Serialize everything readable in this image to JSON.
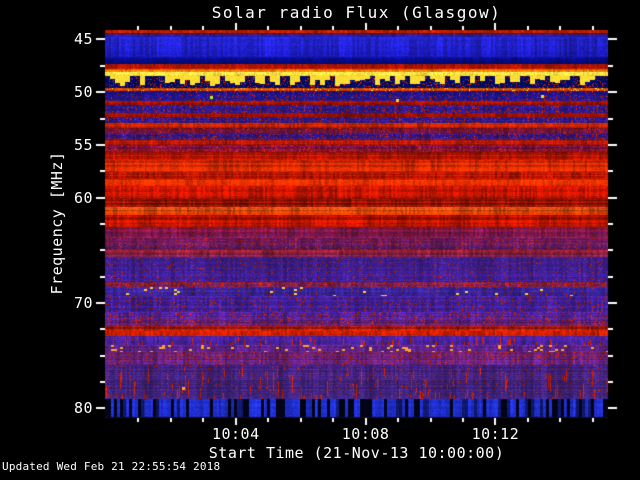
{
  "title": "Solar radio Flux (Glasgow)",
  "footer": {
    "updated": "Updated Wed Feb 21 22:55:54 2018"
  },
  "colors": {
    "background": "#000000",
    "foreground": "#ffffff"
  },
  "axes": {
    "x": {
      "label": "Start Time (21-Nov-13 10:00:00)",
      "date": "21-Nov-13",
      "start_time": "10:00:00",
      "range_seconds": [
        0,
        930
      ],
      "minor_step_seconds": 60,
      "ticks": [
        {
          "label": "10:04",
          "seconds": 240
        },
        {
          "label": "10:08",
          "seconds": 480
        },
        {
          "label": "10:12",
          "seconds": 720
        }
      ]
    },
    "y": {
      "label": "Frequency [MHz]",
      "unit": "MHz",
      "tick_labels": [
        45,
        50,
        55,
        60,
        70,
        80
      ],
      "minor_step_mhz": 2.5,
      "range_mhz": [
        44.2,
        81.0
      ]
    }
  },
  "chart_data": {
    "type": "heatmap",
    "title": "Solar radio Flux (Glasgow)",
    "xlabel": "Start Time (21-Nov-13 10:00:00)",
    "ylabel": "Frequency [MHz]",
    "x_tick_labels": [
      "10:04",
      "10:08",
      "10:12"
    ],
    "y_tick_labels": [
      45,
      50,
      55,
      60,
      70,
      80
    ],
    "x_range": [
      "10:00:00",
      "10:15:30"
    ],
    "y_range_mhz": [
      44.2,
      81.0
    ],
    "legend_position": "none",
    "grid": false,
    "palette": "dark blue/purple = low flux, red = high flux, yellow/white = strongest (RFI lines)",
    "hot_pixels": [
      {
        "t_frac": 0.211,
        "f_mhz": 50.55,
        "c": "#bbee22"
      },
      {
        "t_frac": 0.581,
        "f_mhz": 50.84,
        "c": "#ffcc33"
      },
      {
        "t_frac": 0.868,
        "f_mhz": 50.5,
        "c": "#ccee33"
      },
      {
        "t_frac": 0.155,
        "f_mhz": 78.15,
        "c": "#ffaa33"
      }
    ],
    "bands": [
      {
        "f0": 44.2,
        "f1": 44.48,
        "c0": "#c22000",
        "c1": "#c22000",
        "rv": 0.3,
        "cv": 0.5,
        "label": "red top edge"
      },
      {
        "f0": 44.48,
        "f1": 44.86,
        "c0": "#551133",
        "c1": "#2020bb",
        "rv": 0.2,
        "cv": 0.4
      },
      {
        "f0": 44.86,
        "f1": 46.76,
        "c0": "#2424d2",
        "c1": "#1a1abe",
        "rv": 0.15,
        "cv": 0.5,
        "label": "quiet blue band"
      },
      {
        "f0": 46.76,
        "f1": 47.42,
        "c0": "#0e0ea0",
        "c1": "#000a74",
        "rv": 0.2,
        "cv": 0.35
      },
      {
        "f0": 47.42,
        "f1": 47.9,
        "c0": "#a81500",
        "c1": "#c41a00",
        "rv": 0.35,
        "cv": 0.45
      },
      {
        "f0": 47.9,
        "f1": 48.18,
        "c0": "#e65f00",
        "c1": "#ff9900",
        "rv": 0.2,
        "cv": 0.3
      },
      {
        "f0": 48.18,
        "f1": 48.56,
        "c0": "#ffee55",
        "c1": "#ffdd33",
        "rv": 0.12,
        "cv": 0.22,
        "label": "strong RFI line 48.3 MHz"
      },
      {
        "f0": 48.56,
        "f1": 49.7,
        "c0": "#000a60",
        "c1": "#000a60",
        "rv": 0.2,
        "cv": 0.3,
        "fx": "comb",
        "teeth": "#ffdd33",
        "sp": "#cc2200",
        "sp_p": 0.15,
        "label": "keyed RFI comb"
      },
      {
        "f0": 49.7,
        "f1": 49.99,
        "c0": "#e05500",
        "c1": "#cc3300",
        "rv": 0.3,
        "cv": 0.45,
        "sp": "#ffee44",
        "sp_p": 0.08
      },
      {
        "f0": 49.99,
        "f1": 50.93,
        "c0": "#1a1080",
        "c1": "#241688",
        "rv": 0.25,
        "cv": 0.35,
        "sp": "#bb2200",
        "sp_p": 0.1
      },
      {
        "f0": 50.93,
        "f1": 51.31,
        "c0": "#a81300",
        "c1": "#a81300",
        "rv": 0.4,
        "cv": 0.5
      },
      {
        "f0": 51.31,
        "f1": 52.07,
        "c0": "#281788",
        "c1": "#281788",
        "rv": 0.3,
        "cv": 0.4,
        "sp": "#bb2200",
        "sp_p": 0.14
      },
      {
        "f0": 52.07,
        "f1": 52.45,
        "c0": "#a81300",
        "c1": "#b01500",
        "rv": 0.4,
        "cv": 0.5
      },
      {
        "f0": 52.45,
        "f1": 53.02,
        "c0": "#2a1888",
        "c1": "#2a1888",
        "rv": 0.3,
        "cv": 0.4,
        "sp": "#bb2200",
        "sp_p": 0.14
      },
      {
        "f0": 53.02,
        "f1": 53.5,
        "c0": "#d42800",
        "c1": "#c81e00",
        "rv": 0.35,
        "cv": 0.5
      },
      {
        "f0": 53.5,
        "f1": 54.06,
        "c0": "#701030",
        "c1": "#581448",
        "rv": 0.3,
        "cv": 0.45,
        "sp": "#bb2200",
        "sp_p": 0.12
      },
      {
        "f0": 54.06,
        "f1": 54.63,
        "c0": "#2a1585",
        "c1": "#3a1878",
        "rv": 0.3,
        "cv": 0.4,
        "sp": "#bb2200",
        "sp_p": 0.13
      },
      {
        "f0": 54.63,
        "f1": 55.11,
        "c0": "#b51500",
        "c1": "#b51500",
        "rv": 0.4,
        "cv": 0.5
      },
      {
        "f0": 55.11,
        "f1": 55.77,
        "c0": "#6a1050",
        "c1": "#8c1230",
        "rv": 0.35,
        "cv": 0.45,
        "sp": "#cc2200",
        "sp_p": 0.15
      },
      {
        "f0": 55.77,
        "f1": 56.53,
        "c0": "#b81300",
        "c1": "#c41500",
        "rv": 0.45,
        "cv": 0.5,
        "label": "broadband solar continuum"
      },
      {
        "f0": 56.53,
        "f1": 57.67,
        "c0": "#d82600",
        "c1": "#e03000",
        "rv": 0.4,
        "cv": 0.5
      },
      {
        "f0": 57.67,
        "f1": 58.33,
        "c0": "#c01400",
        "c1": "#c01400",
        "rv": 0.45,
        "cv": 0.55
      },
      {
        "f0": 58.33,
        "f1": 59.0,
        "c0": "#e23500",
        "c1": "#d42500",
        "rv": 0.4,
        "cv": 0.5
      },
      {
        "f0": 59.0,
        "f1": 60.23,
        "c0": "#c21500",
        "c1": "#b81300",
        "rv": 0.45,
        "cv": 0.55
      },
      {
        "f0": 60.23,
        "f1": 60.99,
        "c0": "#8c1000",
        "c1": "#941200",
        "rv": 0.5,
        "cv": 0.55
      },
      {
        "f0": 60.99,
        "f1": 61.75,
        "c0": "#e85515",
        "c1": "#d83800",
        "rv": 0.4,
        "cv": 0.5
      },
      {
        "f0": 61.75,
        "f1": 62.88,
        "c0": "#c01300",
        "c1": "#a81500",
        "rv": 0.45,
        "cv": 0.55
      },
      {
        "f0": 62.88,
        "f1": 63.93,
        "c0": "#8c1535",
        "c1": "#7a1848",
        "rv": 0.4,
        "cv": 0.5,
        "sp": "#5a1a70",
        "sp_p": 0.15
      },
      {
        "f0": 63.93,
        "f1": 65.07,
        "c0": "#6d1858",
        "c1": "#5c1c6e",
        "rv": 0.35,
        "cv": 0.45,
        "sp": "#bb2200",
        "sp_p": 0.12
      },
      {
        "f0": 65.07,
        "f1": 65.73,
        "c0": "#a02030",
        "c1": "#7c2050",
        "rv": 0.4,
        "cv": 0.5
      },
      {
        "f0": 65.73,
        "f1": 68.1,
        "c0": "#3c1e90",
        "c1": "#3c1e90",
        "rv": 0.25,
        "cv": 0.35,
        "sp": "#aa2200",
        "sp_p": 0.07,
        "label": "quiet purple band"
      },
      {
        "f0": 68.1,
        "f1": 68.57,
        "c0": "#6a2060",
        "c1": "#6a2060",
        "rv": 0.3,
        "cv": 0.45,
        "sp": "#cc2200",
        "sp_p": 0.3
      },
      {
        "f0": 68.57,
        "f1": 69.43,
        "c0": "#372399",
        "c1": "#372399",
        "rv": 0.25,
        "cv": 0.4,
        "fx": "dots",
        "dot": "#ffcc44",
        "dot_p": 0.025,
        "sp": "#aa2200",
        "sp_p": 0.05
      },
      {
        "f0": 69.43,
        "f1": 70.95,
        "c0": "#3c1e94",
        "c1": "#40209a",
        "rv": 0.3,
        "cv": 0.4,
        "sp": "#aa2200",
        "sp_p": 0.08
      },
      {
        "f0": 70.95,
        "f1": 72.27,
        "c0": "#44209d",
        "c1": "#5a1c70",
        "rv": 0.35,
        "cv": 0.45,
        "sp": "#cc2200",
        "sp_p": 0.14
      },
      {
        "f0": 72.27,
        "f1": 72.75,
        "c0": "#9c1810",
        "c1": "#b81d05",
        "rv": 0.4,
        "cv": 0.5
      },
      {
        "f0": 72.75,
        "f1": 73.22,
        "c0": "#e82500",
        "c1": "#d02000",
        "rv": 0.3,
        "cv": 0.45,
        "label": "RFI line ~73 MHz"
      },
      {
        "f0": 73.22,
        "f1": 74.08,
        "c0": "#45209a",
        "c1": "#45209a",
        "rv": 0.3,
        "cv": 0.4,
        "fx": "rain",
        "rain": "#cc2200",
        "rain_p": 0.18
      },
      {
        "f0": 74.08,
        "f1": 74.74,
        "c0": "#5c2285",
        "c1": "#5c2285",
        "rv": 0.3,
        "cv": 0.45,
        "fx": "dots",
        "dot": "#ffa030",
        "dot_p": 0.1,
        "label": "sporadic RFI bursts"
      },
      {
        "f0": 74.74,
        "f1": 75.97,
        "c0": "#6a1f70",
        "c1": "#552080",
        "rv": 0.35,
        "cv": 0.45,
        "sp": "#bb2200",
        "sp_p": 0.12
      },
      {
        "f0": 75.97,
        "f1": 79.2,
        "c0": "#432080",
        "c1": "#3a2278",
        "rv": 0.3,
        "cv": 0.4,
        "fx": "rain",
        "rain": "#c32000",
        "rain_p": 0.22,
        "sp": "#aa2200",
        "sp_p": 0.04,
        "label": "red vertical streaks"
      },
      {
        "f0": 79.2,
        "f1": 80.9,
        "c0": "#2233dd",
        "c1": "#1e2cd0",
        "rv": 0.2,
        "cv": 0.45,
        "fx": "darkcols",
        "label": "blue band with dropouts"
      },
      {
        "f0": 80.9,
        "f1": 81.0,
        "c0": "#101024",
        "c1": "#101024",
        "rv": 0,
        "cv": 0
      }
    ]
  }
}
